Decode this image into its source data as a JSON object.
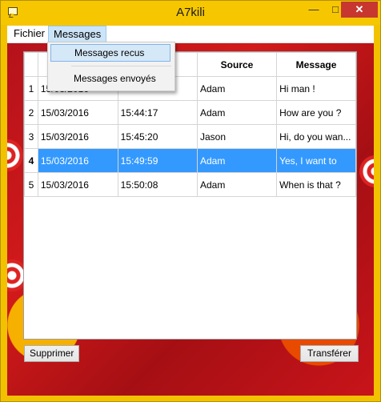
{
  "window": {
    "title": "A7kili",
    "minimize": "—",
    "maximize": "□",
    "close": "✕"
  },
  "menubar": {
    "items": [
      {
        "label": "Fichier"
      },
      {
        "label": "Messages"
      }
    ]
  },
  "dropdown": {
    "items": [
      {
        "label": "Messages recus"
      },
      {
        "label": "Messages envoyés"
      }
    ]
  },
  "table": {
    "headers": {
      "source": "Source",
      "message": "Message"
    },
    "rows": [
      {
        "index": "1",
        "date": "15/03/2016",
        "time": "",
        "source": "Adam",
        "message": "Hi man !"
      },
      {
        "index": "2",
        "date": "15/03/2016",
        "time": "15:44:17",
        "source": "Adam",
        "message": "How are you ?"
      },
      {
        "index": "3",
        "date": "15/03/2016",
        "time": "15:45:20",
        "source": "Jason",
        "message": "Hi, do you wan..."
      },
      {
        "index": "4",
        "date": "15/03/2016",
        "time": "15:49:59",
        "source": "Adam",
        "message": "Yes, I want to"
      },
      {
        "index": "5",
        "date": "15/03/2016",
        "time": "15:50:08",
        "source": "Adam",
        "message": "When is that ?"
      }
    ],
    "selected_index": 4
  },
  "buttons": {
    "delete": "Supprimer",
    "transfer": "Transférer"
  },
  "colors": {
    "selection": "#3399ff",
    "titlebar": "#f6c700",
    "close": "#c7372f"
  }
}
